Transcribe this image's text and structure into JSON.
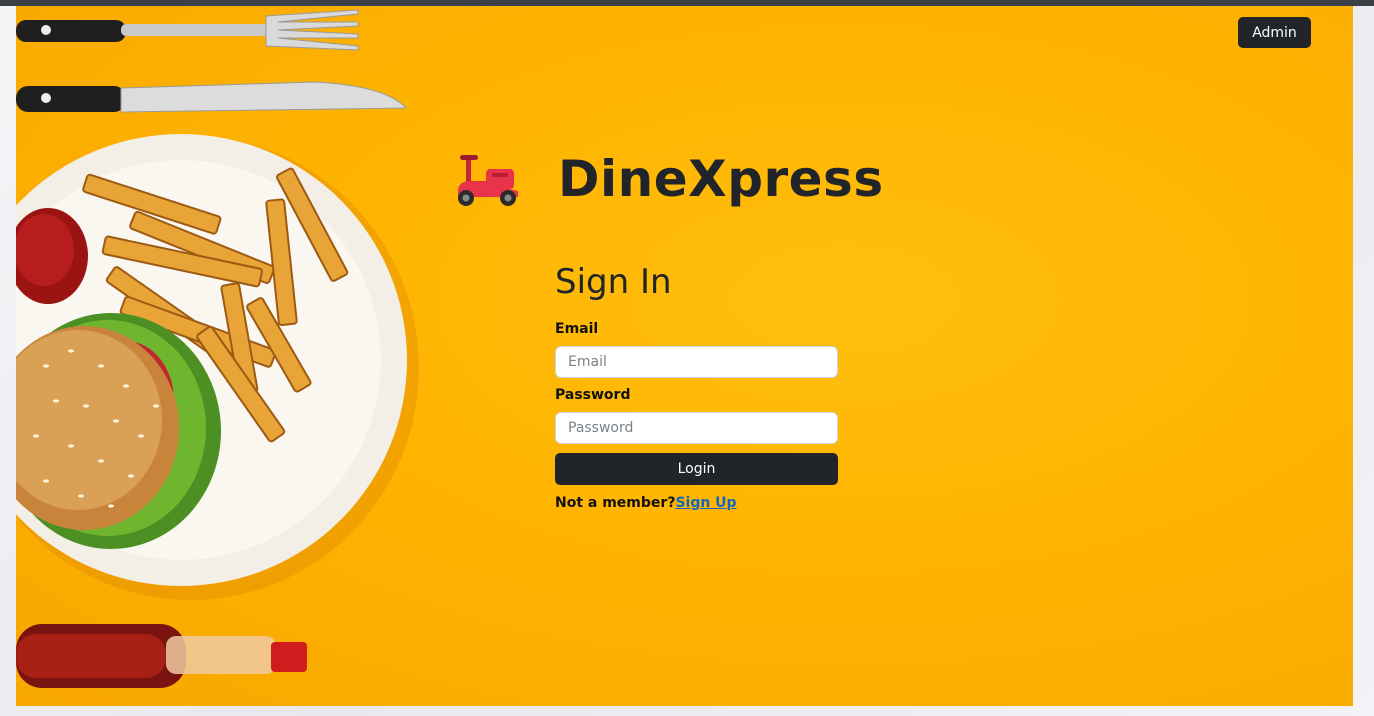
{
  "header": {
    "admin_label": "Admin"
  },
  "brand": {
    "name": "DineXpress",
    "icon": "scooter-icon"
  },
  "signin": {
    "title": "Sign In",
    "email_label": "Email",
    "email_placeholder": "Email",
    "email_value": "",
    "password_label": "Password",
    "password_placeholder": "Password",
    "password_value": "",
    "login_label": "Login",
    "not_member_text": "Not a member?",
    "signup_link": "Sign Up"
  },
  "colors": {
    "background": "#ffb400",
    "dark": "#212529",
    "link": "#1565c0",
    "scooter": "#e8334a"
  }
}
